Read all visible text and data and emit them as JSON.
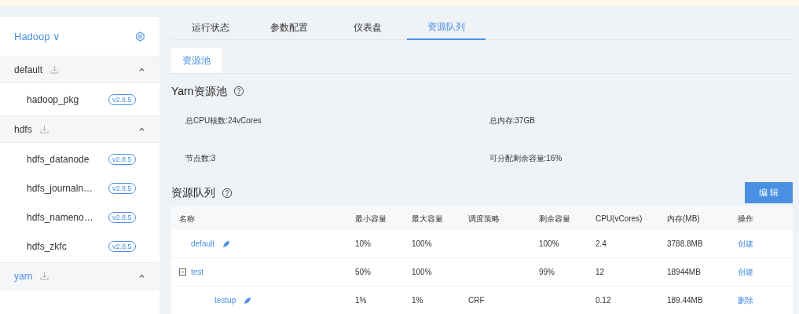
{
  "sidebar": {
    "cluster": "Hadoop ∨",
    "groups": [
      {
        "name": "default",
        "expanded": true,
        "selected": false,
        "items": [
          {
            "name": "hadoop_pkg",
            "version": "v2.8.5"
          }
        ]
      },
      {
        "name": "hdfs",
        "expanded": true,
        "selected": false,
        "items": [
          {
            "name": "hdfs_datanode",
            "version": "v2.8.5"
          },
          {
            "name": "hdfs_journaln…",
            "version": "v2.8.5"
          },
          {
            "name": "hdfs_nameno…",
            "version": "v2.8.5"
          },
          {
            "name": "hdfs_zkfc",
            "version": "v2.8.5"
          }
        ]
      },
      {
        "name": "yarn",
        "expanded": true,
        "selected": true
      }
    ]
  },
  "tabs": [
    {
      "label": "运行状态",
      "selected": false
    },
    {
      "label": "参数配置",
      "selected": false
    },
    {
      "label": "仪表盘",
      "selected": false
    },
    {
      "label": "资源队列",
      "selected": true
    }
  ],
  "subtabs": [
    {
      "label": "资源池",
      "selected": true
    }
  ],
  "pool": {
    "title": "Yarn资源池",
    "stats": [
      "总CPU核数:24vCores",
      "总内存:37GB",
      "节点数:3",
      "可分配剩余容量:16%"
    ]
  },
  "queue": {
    "title": "资源队列",
    "edit_button": "编 辑",
    "columns": [
      "名称",
      "最小容量",
      "最大容量",
      "调度策略",
      "剩余容量",
      "CPU(vCores)",
      "内存(MB)",
      "操作"
    ],
    "rows": [
      {
        "kind": "leaf",
        "cells": [
          "default",
          "10%",
          "100%",
          "",
          "100%",
          "2.4",
          "3788.8MB",
          "创建"
        ]
      },
      {
        "kind": "parent",
        "expanded": true,
        "cells": [
          "test",
          "50%",
          "100%",
          "",
          "99%",
          "12",
          "18944MB",
          "创建"
        ],
        "children": [
          {
            "kind": "leaf",
            "cells": [
              "testup",
              "1%",
              "1%",
              "CRF",
              "",
              "0.12",
              "189.44MB",
              "删除"
            ]
          }
        ]
      }
    ]
  }
}
